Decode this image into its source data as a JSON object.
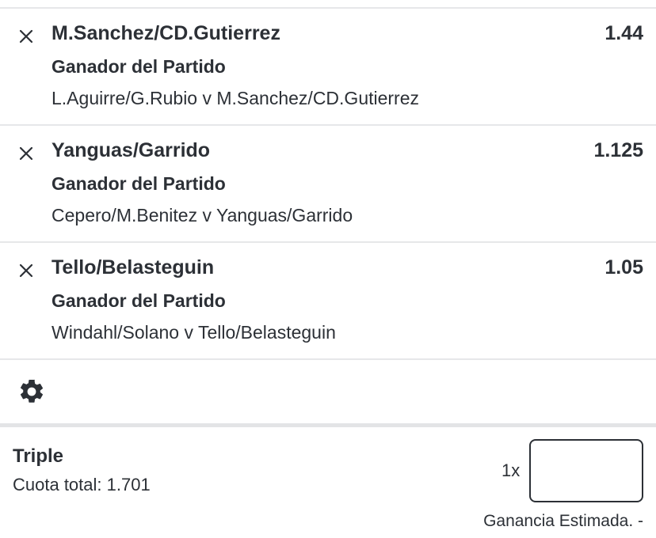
{
  "selections": [
    {
      "name": "M.Sanchez/CD.Gutierrez",
      "odds": "1.44",
      "market": "Ganador del Partido",
      "event": "L.Aguirre/G.Rubio v M.Sanchez/CD.Gutierrez"
    },
    {
      "name": "Yanguas/Garrido",
      "odds": "1.125",
      "market": "Ganador del Partido",
      "event": "Cepero/M.Benitez v Yanguas/Garrido"
    },
    {
      "name": "Tello/Belasteguin",
      "odds": "1.05",
      "market": "Ganador del Partido",
      "event": "Windahl/Solano v Tello/Belasteguin"
    }
  ],
  "icons": {
    "remove": "close-icon",
    "settings": "gear-icon"
  },
  "bet": {
    "type": "Triple",
    "total_odds": "Cuota total: 1.701",
    "multiplier": "1x",
    "stake_value": "",
    "estimated_win": "Ganancia Estimada. -"
  },
  "colors": {
    "text": "#2c3036",
    "divider": "#e6e7e9",
    "background": "#ffffff"
  }
}
